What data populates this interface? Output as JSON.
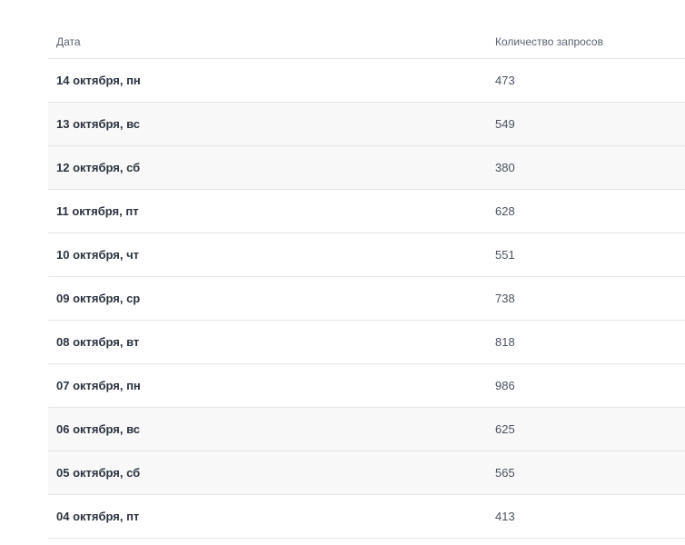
{
  "table": {
    "headers": {
      "date": "Дата",
      "count": "Количество запросов"
    },
    "rows": [
      {
        "date": "14 октября, пн",
        "count": "473"
      },
      {
        "date": "13 октября, вс",
        "count": "549"
      },
      {
        "date": "12 октября, сб",
        "count": "380"
      },
      {
        "date": "11 октября, пт",
        "count": "628"
      },
      {
        "date": "10 октября, чт",
        "count": "551"
      },
      {
        "date": "09 октября, ср",
        "count": "738"
      },
      {
        "date": "08 октября, вт",
        "count": "818"
      },
      {
        "date": "07 октября, пн",
        "count": "986"
      },
      {
        "date": "06 октября, вс",
        "count": "625"
      },
      {
        "date": "05 октября, сб",
        "count": "565"
      },
      {
        "date": "04 октября, пт",
        "count": "413"
      }
    ]
  }
}
